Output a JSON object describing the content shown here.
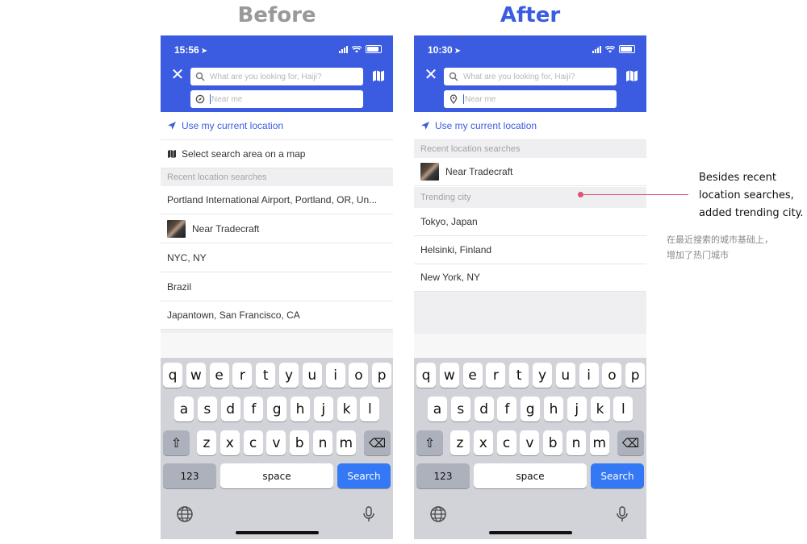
{
  "headings": {
    "before": "Before",
    "after": "After"
  },
  "before": {
    "time": "15:56",
    "search_placeholder": "What are you looking for, Haiji?",
    "location_placeholder": "Near me",
    "use_location": "Use my current location",
    "select_area": "Select search area on a map",
    "recent_header": "Recent location searches",
    "recent_items": [
      "Portland International Airport, Portland, OR, Un...",
      "Near Tradecraft",
      "NYC, NY",
      "Brazil",
      "Japantown, San Francisco, CA"
    ]
  },
  "after": {
    "time": "10:30",
    "search_placeholder": "What are you looking for, Haiji?",
    "location_placeholder": "Near me",
    "use_location": "Use my current location",
    "recent_header": "Recent location searches",
    "recent_items": [
      "Near Tradecraft"
    ],
    "trending_header": "Trending city",
    "trending_items": [
      "Tokyo, Japan",
      "Helsinki, Finland",
      "New York, NY"
    ]
  },
  "keyboard": {
    "row1": [
      "q",
      "w",
      "e",
      "r",
      "t",
      "y",
      "u",
      "i",
      "o",
      "p"
    ],
    "row2": [
      "a",
      "s",
      "d",
      "f",
      "g",
      "h",
      "j",
      "k",
      "l"
    ],
    "row3": [
      "z",
      "x",
      "c",
      "v",
      "b",
      "n",
      "m"
    ],
    "numbers_key": "123",
    "space_key": "space",
    "search_key": "Search"
  },
  "callout": {
    "en_lines": [
      "Besides recent",
      "location searches,",
      "added trending city."
    ],
    "zh_lines": [
      "在最近搜索的城市基础上，",
      "增加了热门城市"
    ],
    "color": "#e0507a"
  },
  "colors": {
    "brand_blue": "#3b5ce0",
    "search_key": "#3478f6"
  }
}
